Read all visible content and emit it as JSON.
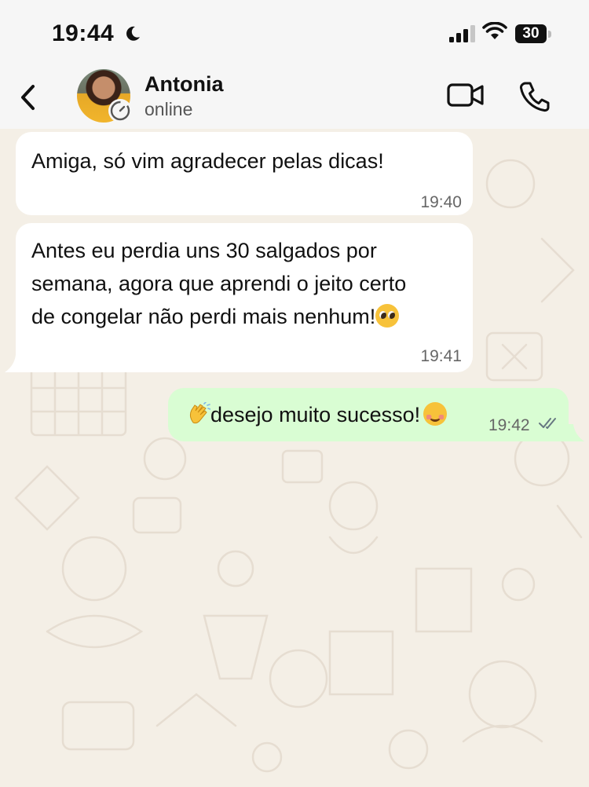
{
  "status_bar": {
    "time": "19:44",
    "battery": "30",
    "icons": [
      "moon-icon",
      "signal-icon",
      "wifi-icon",
      "battery-icon"
    ]
  },
  "header": {
    "contact_name": "Antonia",
    "contact_status": "online",
    "icons": [
      "back-arrow-icon",
      "avatar",
      "disappearing-timer-icon",
      "video-camera-icon",
      "phone-icon"
    ]
  },
  "messages": [
    {
      "direction": "incoming",
      "text": "Amiga, só vim agradecer pelas dicas!",
      "time": "19:40"
    },
    {
      "direction": "incoming",
      "lines": [
        "Antes eu perdia uns 30 salgados por",
        "semana, agora que aprendi o jeito certo",
        "de congelar não perdi mais nenhum!"
      ],
      "emoji": "pleading-face-emoji",
      "time": "19:41"
    },
    {
      "direction": "outgoing",
      "emoji_before": "clapping-hands-emoji",
      "text": "desejo muito sucesso!",
      "emoji_after": "smiling-face-emoji",
      "time": "19:42",
      "status": "read-double-check-icon"
    }
  ],
  "colors": {
    "wallpaper": "#f4efe6",
    "incoming_bubble": "#ffffff",
    "outgoing_bubble": "#d9fdd3",
    "header": "#f6f6f6",
    "read_ticks": "#667781"
  }
}
